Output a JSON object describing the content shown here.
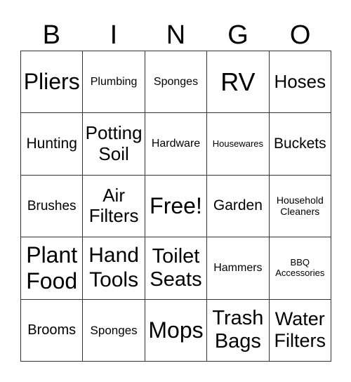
{
  "header": [
    "B",
    "I",
    "N",
    "G",
    "O"
  ],
  "cells": [
    "Pliers",
    "Plumbing",
    "Sponges",
    "RV",
    "Hoses",
    "Hunting",
    "Potting\nSoil",
    "Hardware",
    "Housewares",
    "Buckets",
    "Brushes",
    "Air\nFilters",
    "Free!",
    "Garden",
    "Household\nCleaners",
    "Plant\nFood",
    "Hand\nTools",
    "Toilet\nSeats",
    "Hammers",
    "BBQ\nAccessories",
    "Brooms",
    "Sponges",
    "Mops",
    "Trash\nBags",
    "Water\nFilters"
  ]
}
